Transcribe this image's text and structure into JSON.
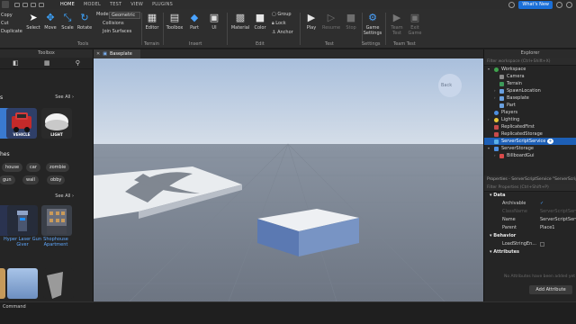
{
  "menubar": {
    "tabs": [
      "HOME",
      "MODEL",
      "TEST",
      "VIEW",
      "PLUGINS"
    ],
    "whats_new": "What's New"
  },
  "ribbon": {
    "clipboard": {
      "copy": "Copy",
      "cut": "Cut",
      "duplicate": "Duplicate"
    },
    "tools": [
      "Select",
      "Move",
      "Scale",
      "Rotate"
    ],
    "mode": {
      "label": "Mode",
      "value": "Geometric",
      "collisions": "Collisions",
      "join_surfaces": "Join Surfaces"
    },
    "groups": {
      "tools": "Tools",
      "terrain": "Terrain",
      "insert": "Insert",
      "edit": "Edit",
      "test": "Test",
      "settings": "Settings",
      "team_test": "Team Test"
    },
    "editor": "Editor",
    "toolbox": "Toolbox",
    "part": "Part",
    "ui": "UI",
    "material": "Material",
    "color": "Color",
    "group": "Group",
    "lock": "Lock",
    "anchor": "Anchor",
    "play": "Play",
    "resume": "Resume",
    "stop": "Stop",
    "game_settings": [
      "Game",
      "Settings"
    ],
    "team_create": [
      "Team",
      "Test"
    ],
    "exit_game": [
      "Exit",
      "Game"
    ],
    "colors": {
      "accent": "#1a6fd8",
      "move": "#3da5ff",
      "part": "#4aa3ff"
    }
  },
  "toolbox": {
    "title": "Toolbox",
    "section1": {
      "title": "s",
      "see_all": "See All ›"
    },
    "cards": [
      "VEHICLE",
      "LIGHT"
    ],
    "section2": {
      "title": "hes"
    },
    "chips": [
      "house",
      "car",
      "zombie",
      "gun",
      "wall",
      "obby"
    ],
    "section3": {
      "see_all": "See All ›"
    },
    "assets": [
      {
        "name": "Hyper Laser Gun Giver"
      },
      {
        "name": "Shophouse Apartment"
      }
    ]
  },
  "viewport": {
    "tab": "Baseplate",
    "nav_cube": "Back"
  },
  "explorer": {
    "title": "Explorer",
    "filter_placeholder": "Filter workspace (Ctrl+Shift+X)",
    "items": [
      {
        "label": "Workspace",
        "level": 0,
        "expanded": true
      },
      {
        "label": "Camera",
        "level": 1
      },
      {
        "label": "Terrain",
        "level": 1
      },
      {
        "label": "SpawnLocation",
        "level": 1,
        "collapsed": true
      },
      {
        "label": "Baseplate",
        "level": 1,
        "collapsed": true
      },
      {
        "label": "Part",
        "level": 1
      },
      {
        "label": "Players",
        "level": 0
      },
      {
        "label": "Lighting",
        "level": 0,
        "collapsed": true
      },
      {
        "label": "ReplicatedFirst",
        "level": 0
      },
      {
        "label": "ReplicatedStorage",
        "level": 0
      },
      {
        "label": "ServerScriptService",
        "level": 0,
        "selected": true
      },
      {
        "label": "ServerStorage",
        "level": 0,
        "expanded": true
      },
      {
        "label": "BillboardGui",
        "level": 1,
        "collapsed": true
      }
    ]
  },
  "properties": {
    "title": "Properties - ServerScriptService \"ServerScriptService\"",
    "filter_placeholder": "Filter Properties (Ctrl+Shift+P)",
    "data_header": "Data",
    "rows": [
      {
        "key": "Archivable",
        "value": "✓",
        "dim": false
      },
      {
        "key": "ClassName",
        "value": "ServerScriptService",
        "dim": true
      },
      {
        "key": "Name",
        "value": "ServerScriptService",
        "dim": false
      },
      {
        "key": "Parent",
        "value": "Place1",
        "dim": false
      }
    ],
    "behavior_header": "Behavior",
    "behavior_rows": [
      {
        "key": "LoadStringEn...",
        "value": "",
        "dim": false
      }
    ],
    "attributes_header": "Attributes",
    "no_attributes": "No Attributes have been added yet",
    "add_attribute": "Add Attribute"
  },
  "bottom": {
    "command": "Command"
  }
}
